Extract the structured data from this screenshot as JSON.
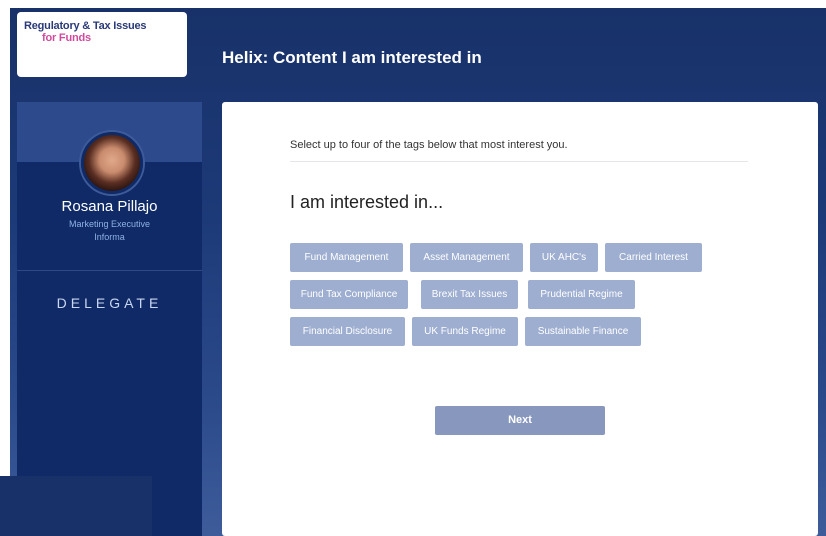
{
  "logo": {
    "line1": "Regulatory & Tax Issues",
    "line2": "for Funds"
  },
  "header": {
    "title": "Helix: Content I am interested in"
  },
  "sidebar": {
    "user_name": "Rosana Pillajo",
    "user_role": "Marketing Executive",
    "user_company": "Informa",
    "role_badge": "DELEGATE"
  },
  "main": {
    "instruction": "Select up to four of the tags below that most interest you.",
    "heading": "I am interested in...",
    "tags": [
      "Fund Management",
      "Asset Management",
      "UK AHC's",
      "Carried Interest",
      "Fund Tax Compliance",
      "Brexit Tax Issues",
      "Prudential Regime",
      "Financial Disclosure",
      "UK Funds Regime",
      "Sustainable Finance"
    ],
    "next_label": "Next"
  },
  "colors": {
    "header_bg": "#183169",
    "sidebar_bg": "#0f2a66",
    "tag_bg": "#9eaed0",
    "button_bg": "#8797bd",
    "logo_accent": "#d24a9e"
  }
}
